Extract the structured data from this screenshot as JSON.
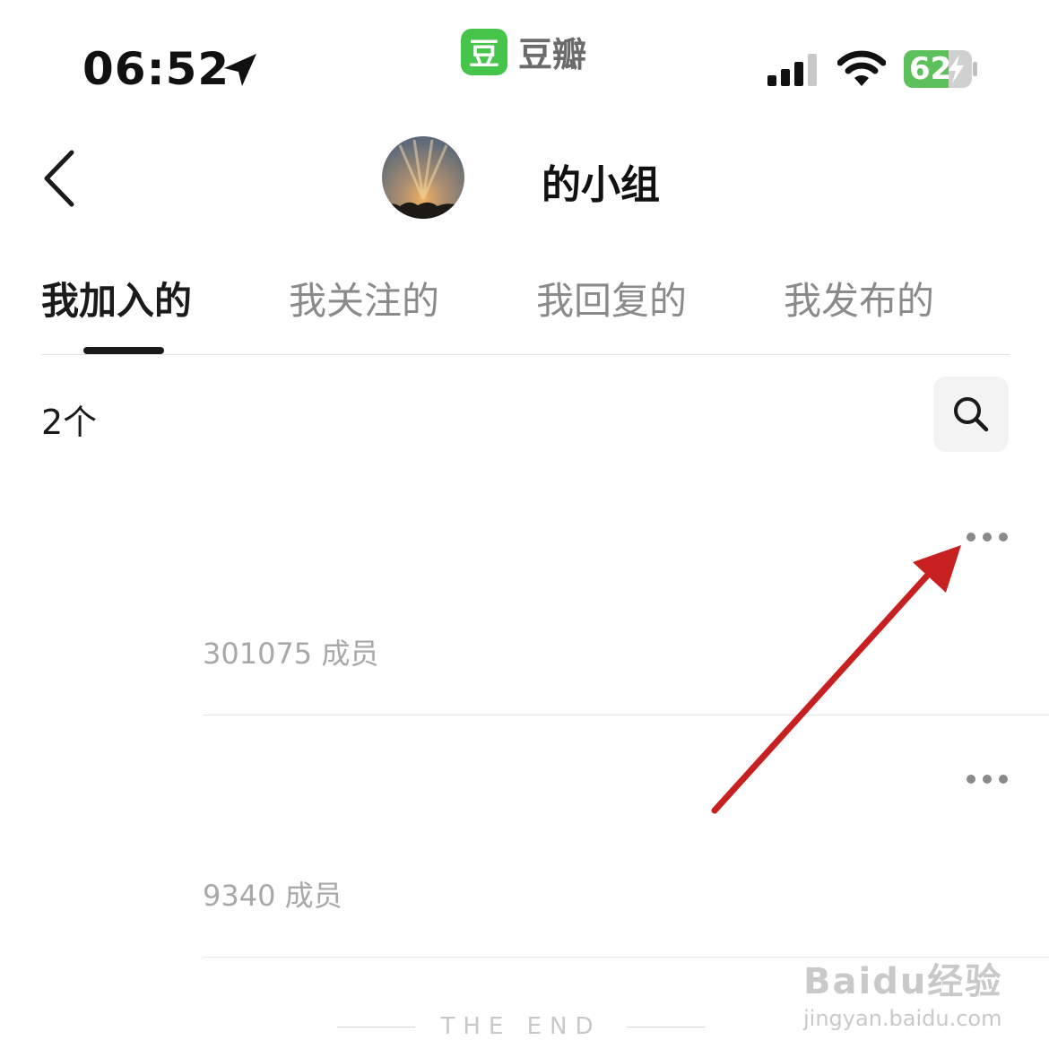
{
  "status_bar": {
    "time": "06:52",
    "app_icon_char": "豆",
    "app_name": "豆瓣",
    "battery": "62"
  },
  "header": {
    "title": "的小组"
  },
  "tabs": [
    {
      "label": "我加入的",
      "active": true
    },
    {
      "label": "我关注的",
      "active": false
    },
    {
      "label": "我回复的",
      "active": false
    },
    {
      "label": "我发布的",
      "active": false
    }
  ],
  "list": {
    "count": "2个",
    "groups": [
      {
        "members": "301075 成员"
      },
      {
        "members": "9340 成员"
      }
    ],
    "end_text": "THE END"
  },
  "watermark": {
    "brand": "Baidu经验",
    "url": "jingyan.baidu.com"
  },
  "colors": {
    "accent_green": "#47c54a",
    "annotation_arrow": "#c62020"
  }
}
